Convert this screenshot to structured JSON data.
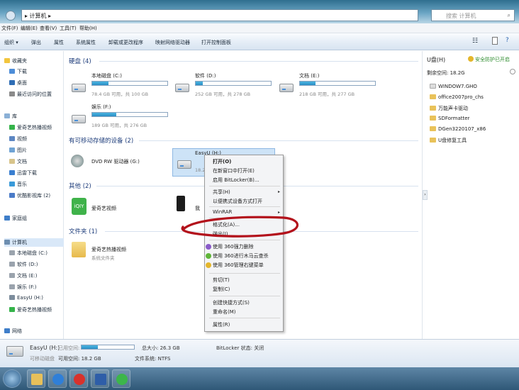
{
  "address": {
    "breadcrumb": "▸ 计算机 ▸",
    "search_placeholder": "搜索 计算机",
    "search_icon": "magnifier-icon"
  },
  "menubar": [
    "文件(F)",
    "编辑(E)",
    "查看(V)",
    "工具(T)",
    "帮助(H)"
  ],
  "toolbar": [
    "组织 ▾",
    "弹出",
    "属性",
    "系统属性",
    "卸载或更改程序",
    "映射网络驱动器",
    "打开控制面板"
  ],
  "sidebar": {
    "favorites": {
      "title": "收藏夹",
      "items": [
        "下载",
        "桌面",
        "最近访问的位置"
      ]
    },
    "library": {
      "title": "库",
      "items": [
        "爱奇艺热播视频",
        "视频",
        "图片",
        "文档",
        "迅雷下载",
        "音乐",
        "优酷影视库 (2)"
      ]
    },
    "homegroup": "家庭组",
    "computer": {
      "title": "计算机",
      "items": [
        "本地磁盘 (C:)",
        "软件 (D:)",
        "文档 (E:)",
        "娱乐 (F:)",
        "EasyU (H:)",
        "爱奇艺热播视频"
      ]
    },
    "network": "网络"
  },
  "main": {
    "hdd_section": "硬盘 (4)",
    "drives": [
      {
        "name": "本地磁盘 (C:)",
        "detail": "78.4 GB 可用，共 100 GB",
        "used": 0.22
      },
      {
        "name": "软件 (D:)",
        "detail": "252 GB 可用，共 278 GB",
        "used": 0.09
      },
      {
        "name": "文档 (E:)",
        "detail": "218 GB 可用，共 277 GB",
        "used": 0.21
      },
      {
        "name": "娱乐 (F:)",
        "detail": "189 GB 可用，共 276 GB",
        "used": 0.32
      }
    ],
    "removable_section": "有可移动存储的设备 (2)",
    "dvd": "DVD RW 驱动器 (G:)",
    "usb": {
      "name": "EasyU (H:)",
      "detail": "18.2"
    },
    "other_section": "其他 (2)",
    "other_items": [
      "爱奇艺视频",
      "我"
    ],
    "folder_section": "文件夹 (1)",
    "folder": {
      "name": "爱奇艺热播视频",
      "sub": "系统文件夹"
    }
  },
  "context_menu": {
    "items": [
      "打开(O)",
      "在新窗口中打开(E)",
      "启用 BitLocker(B)...",
      "共享(H)",
      "以便携式设备方式打开",
      "WinRAR",
      "格式化(A)...",
      "弹出(J)",
      "使用 360强力删除",
      "使用 360进行木马云查杀",
      "使用 360管理右键菜单",
      "剪切(T)",
      "复制(C)",
      "创建快捷方式(S)",
      "重命名(M)",
      "属性(R)"
    ]
  },
  "right_panel": {
    "drive": "U盘(H)",
    "security": "安全防护已开启",
    "free_label": "剩余空间: 18.2G",
    "files": [
      "WINDOW7.GHO",
      "office2007pro_chs",
      "万能声卡驱动",
      "SDFormatter",
      "DGen3220107_x86",
      "U盘修复工具"
    ]
  },
  "status": {
    "name": "EasyU (H:)",
    "used_label": "已用空间:",
    "total": "总大小: 26.3 GB",
    "bitlocker": "BitLocker 状态: 关闭",
    "type": "可移动磁盘",
    "free": "可用空间: 18.2 GB",
    "fs": "文件系统: NTFS",
    "used_fraction": 0.31
  },
  "taskbar": {
    "icons": [
      "start-orb-icon",
      "file-explorer-icon",
      "ie-browser-icon",
      "baidu-icon",
      "wechat-icon"
    ]
  }
}
